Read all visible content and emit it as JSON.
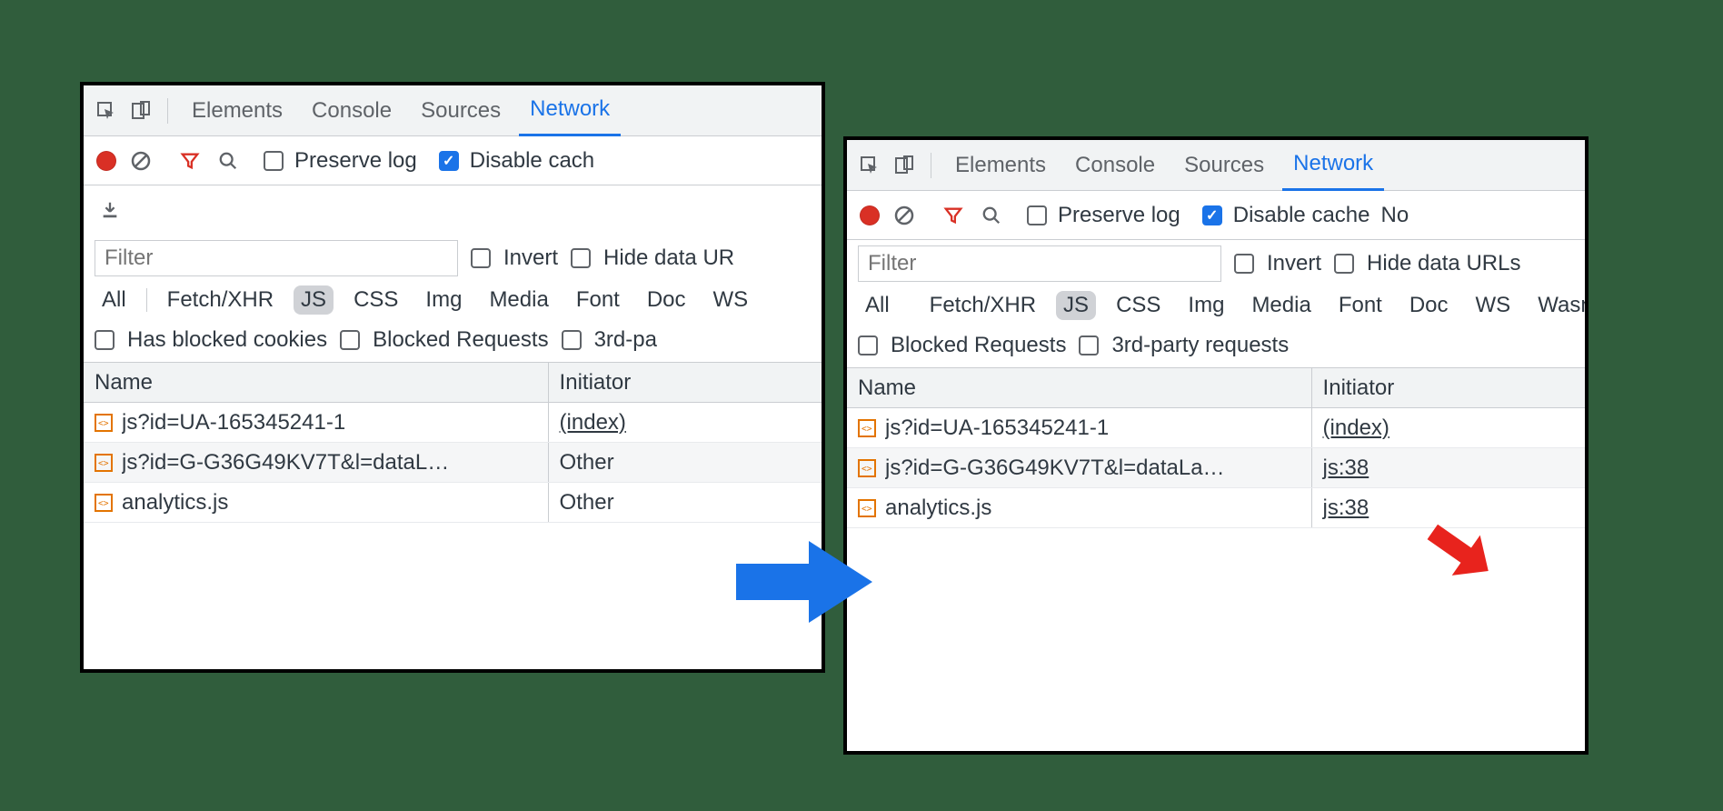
{
  "tabs": {
    "elements": "Elements",
    "console": "Console",
    "sources": "Sources",
    "network": "Network"
  },
  "toolbar": {
    "preserve_log": "Preserve log",
    "disable_cache_full": "Disable cache",
    "disable_cache_cut": "Disable cach",
    "no_cut": "No"
  },
  "filter": {
    "placeholder": "Filter",
    "invert": "Invert",
    "hide_data_urls_full": "Hide data URLs",
    "hide_data_urls_cut": "Hide data UR"
  },
  "types": {
    "all": "All",
    "fetch": "Fetch/XHR",
    "js": "JS",
    "css": "CSS",
    "img": "Img",
    "media": "Media",
    "font": "Font",
    "doc": "Doc",
    "ws": "WS",
    "wasm_cut": "Wasn"
  },
  "checks": {
    "has_blocked_cookies": "Has blocked cookies",
    "blocked_requests": "Blocked Requests",
    "third_party_cut": "3rd-pa",
    "third_party_full": "3rd-party requests"
  },
  "cols": {
    "name": "Name",
    "initiator": "Initiator"
  },
  "left_rows": [
    {
      "name": "js?id=UA-165345241-1",
      "initiator": "(index)",
      "link": true
    },
    {
      "name": "js?id=G-G36G49KV7T&l=dataL…",
      "initiator": "Other",
      "link": false
    },
    {
      "name": "analytics.js",
      "initiator": "Other",
      "link": false
    }
  ],
  "right_rows": [
    {
      "name": "js?id=UA-165345241-1",
      "initiator": "(index)",
      "link": true
    },
    {
      "name": "js?id=G-G36G49KV7T&l=dataLa…",
      "initiator": "js:38",
      "link": true
    },
    {
      "name": "analytics.js",
      "initiator": "js:38",
      "link": true
    }
  ]
}
